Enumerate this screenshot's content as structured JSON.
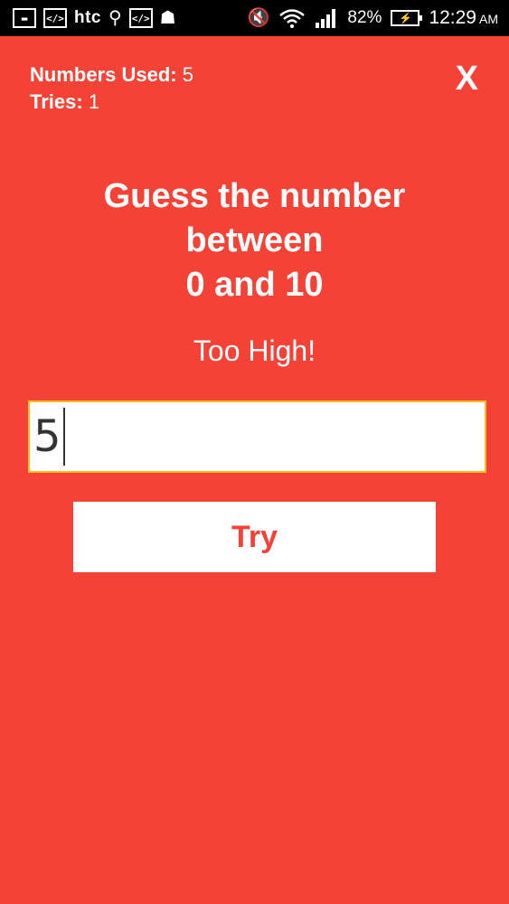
{
  "status_bar": {
    "carrier": "htc",
    "battery_percent": "82%",
    "battery_icon_glyph": "⚡",
    "time": "12:29",
    "ampm": "AM",
    "icons": [
      "gallery-icon",
      "dev-code-icon",
      "usb-icon",
      "dev-code-icon",
      "android-icon",
      "mute-icon",
      "wifi-icon",
      "signal-icon",
      "battery-charging-icon"
    ]
  },
  "game": {
    "numbers_used_label": "Numbers Used:",
    "numbers_used_value": "5",
    "tries_label": "Tries:",
    "tries_value": "1",
    "close_label": "X",
    "heading_line1": "Guess the number",
    "heading_line2": "between",
    "heading_line3": "0 and 10",
    "feedback": "Too High!",
    "input_value": "5",
    "try_label": "Try"
  },
  "colors": {
    "background": "#f44336",
    "button_text": "#f44336",
    "input_border": "#f0c020"
  }
}
